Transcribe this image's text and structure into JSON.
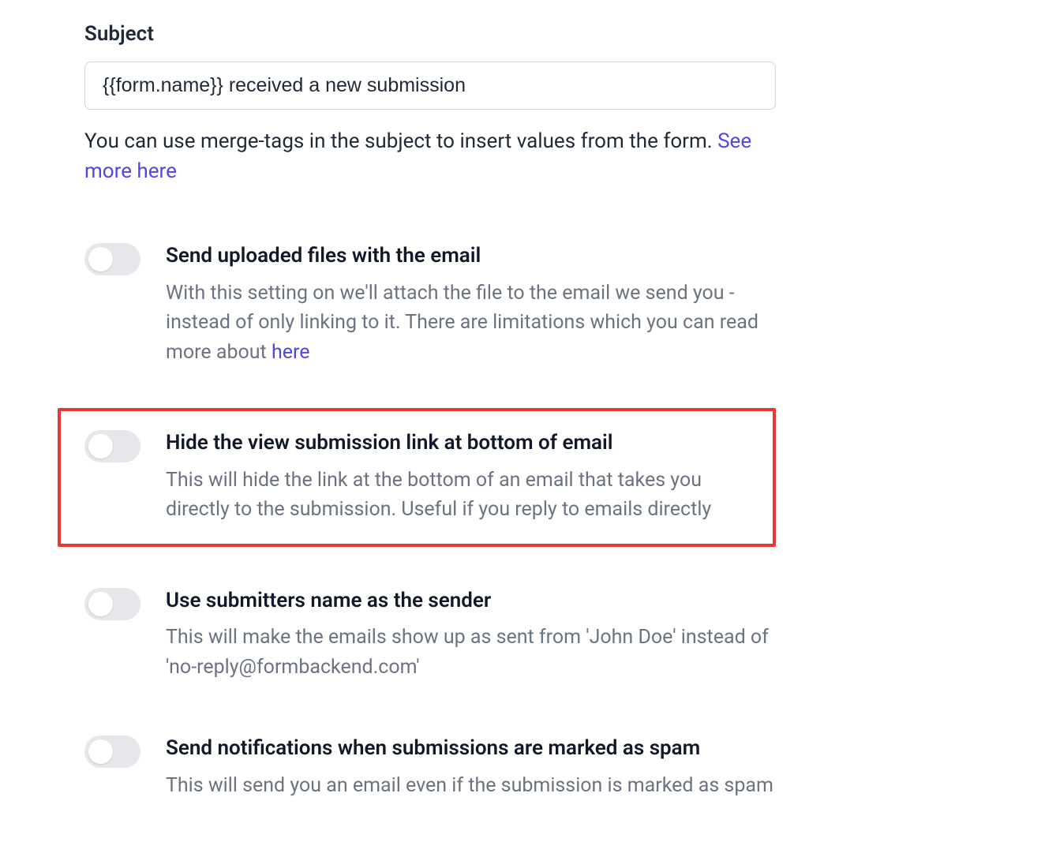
{
  "subject": {
    "label": "Subject",
    "value": "{{form.name}} received a new submission",
    "helper_pre": "You can use merge-tags in the subject to insert values from the form. ",
    "helper_link": "See more here"
  },
  "toggles": {
    "attach_files": {
      "title": "Send uploaded files with the email",
      "desc_pre": "With this setting on we'll attach the file to the email we send you - instead of only linking to it. There are limitations which you can read more about ",
      "desc_link": "here",
      "on": false
    },
    "hide_link": {
      "title": "Hide the view submission link at bottom of email",
      "desc": "This will hide the link at the bottom of an email that takes you directly to the submission. Useful if you reply to emails directly",
      "on": false,
      "highlighted": true
    },
    "sender_name": {
      "title": "Use submitters name as the sender",
      "desc": "This will make the emails show up as sent from 'John Doe' instead of 'no-reply@formbackend.com'",
      "on": false
    },
    "spam_notify": {
      "title": "Send notifications when submissions are marked as spam",
      "desc": "This will send you an email even if the submission is marked as spam",
      "on": false
    }
  }
}
